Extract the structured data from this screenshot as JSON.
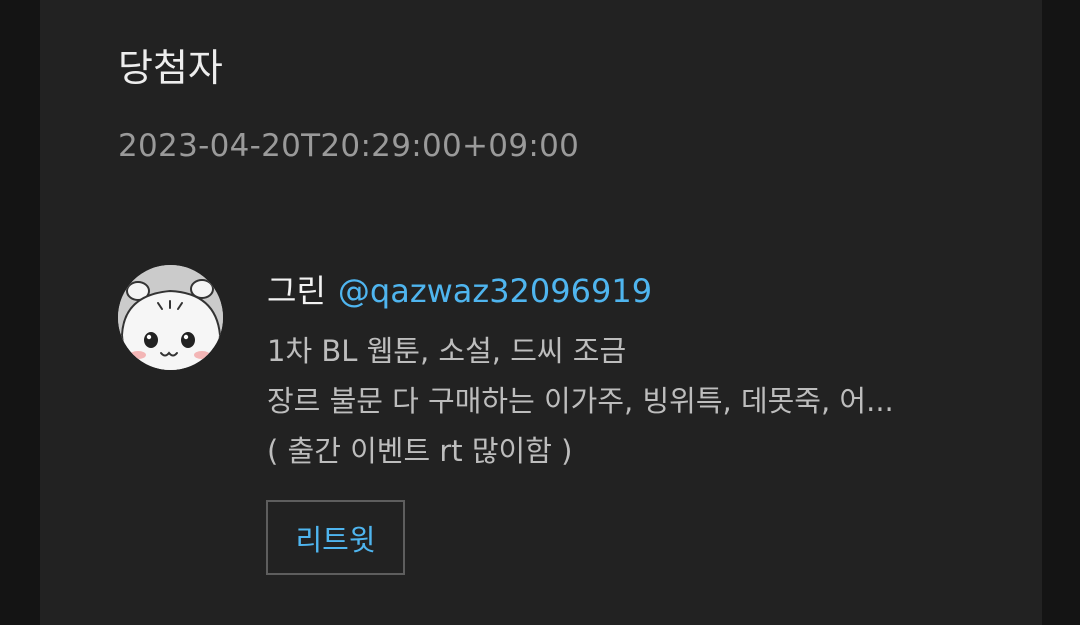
{
  "announcement": {
    "title": "당첨자",
    "timestamp": "2023-04-20T20:29:00+09:00"
  },
  "winner": {
    "name": "그린",
    "handle": "@qazwaz32096919",
    "avatar_icon": "hamster-avatar-icon",
    "bio_lines": [
      "1차 BL 웹툰, 소설, 드씨 조금",
      "장르 불문 다 구매하는 이가주, 빙위특, 데못죽, 어...",
      "( 출간 이벤트 rt 많이함 )"
    ]
  },
  "actions": {
    "retweet_label": "리트윗"
  },
  "colors": {
    "background": "#141414",
    "panel": "#222222",
    "accent": "#4fb5ef",
    "text_primary": "#ededed",
    "text_secondary": "#9a9a9a",
    "button_border": "#5e5e5e"
  }
}
